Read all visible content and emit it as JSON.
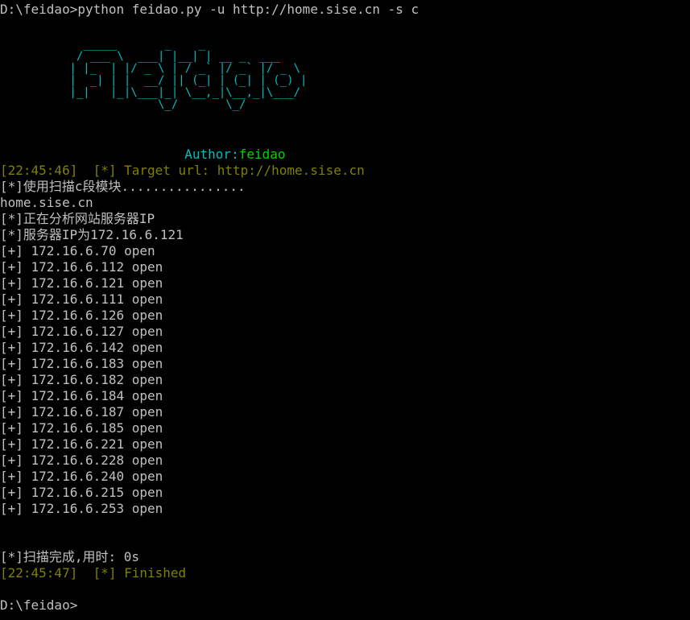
{
  "command_line": "D:\\feidao>python feidao.py -u http://home.sise.cn -s c",
  "banner": {
    "art": "   _____       _    _      \n  / ___ \\  ___| |__| | __ _  ___  \n | |_  | |/ _ \\ | / _` |/ _` |/ _ \\ \n |  _| | |  __/ || (_| | (_| | (_) |\n |_|   |_|\\___|_| \\__,_|\\__,_|\\___/ \n              \\_/       \\_/    ",
    "author_label": "Author:",
    "author_name": "feidao"
  },
  "log": {
    "target_line": "[22:45:46]  [*] Target url: http://home.sise.cn",
    "module_line": "[*]使用扫描c段模块................",
    "host_line": "home.sise.cn",
    "analyzing_line": "[*]正在分析网站服务器IP",
    "server_ip_line": "[*]服务器IP为172.16.6.121",
    "results": [
      "[+] 172.16.6.70 open",
      "[+] 172.16.6.112 open",
      "[+] 172.16.6.121 open",
      "[+] 172.16.6.111 open",
      "[+] 172.16.6.126 open",
      "[+] 172.16.6.127 open",
      "[+] 172.16.6.142 open",
      "[+] 172.16.6.183 open",
      "[+] 172.16.6.182 open",
      "[+] 172.16.6.184 open",
      "[+] 172.16.6.187 open",
      "[+] 172.16.6.185 open",
      "[+] 172.16.6.221 open",
      "[+] 172.16.6.228 open",
      "[+] 172.16.6.240 open",
      "[+] 172.16.6.215 open",
      "[+] 172.16.6.253 open"
    ],
    "done_line": "[*]扫描完成,用时: 0s",
    "finished_line": "[22:45:47]  [*] Finished"
  },
  "prompt_line": "D:\\feidao>",
  "colors": {
    "background": "#000000",
    "text": "#c0c0c0",
    "olive": "#808000",
    "cyan": "#00bcbc",
    "green": "#00d700"
  }
}
